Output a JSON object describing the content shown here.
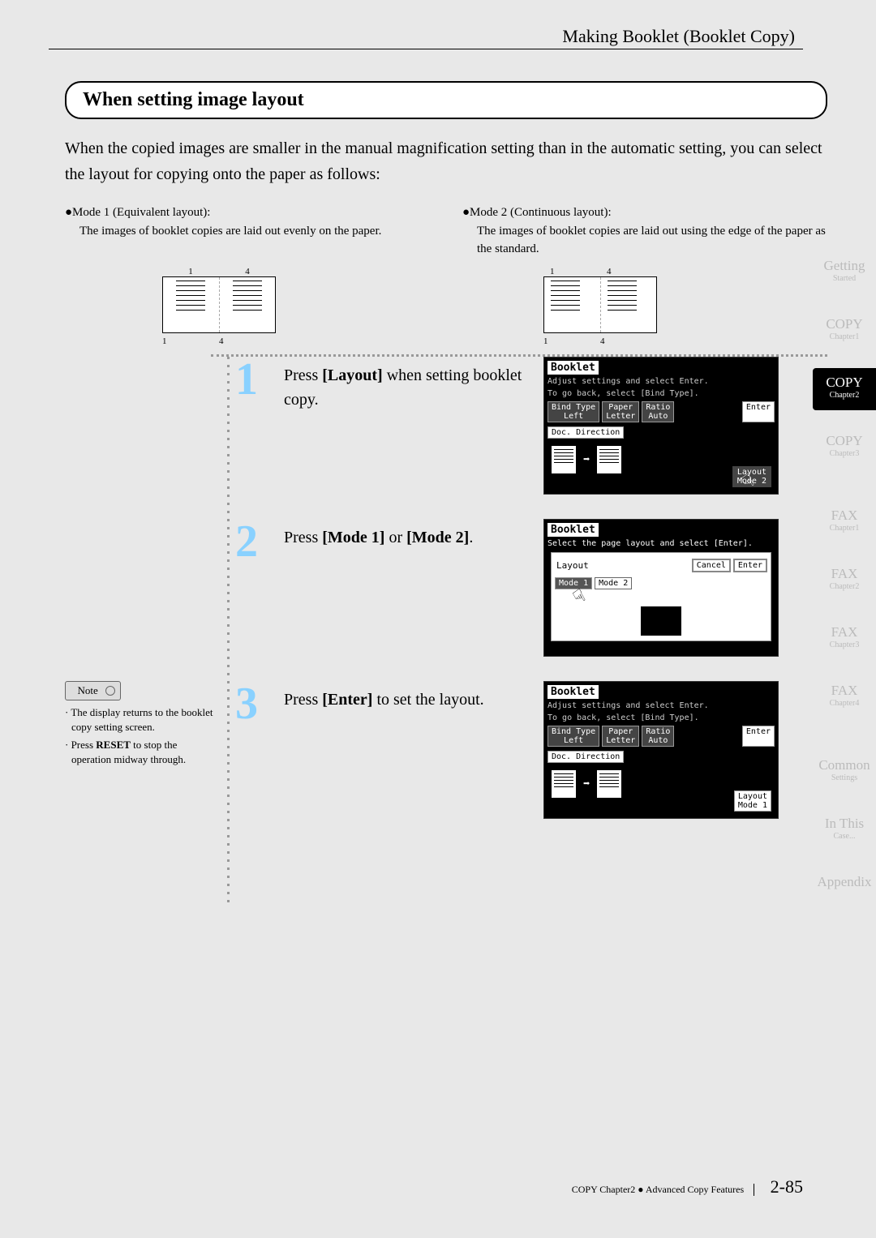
{
  "header": {
    "title": "Making Booklet (Booklet Copy)"
  },
  "section": {
    "title": "When setting image layout",
    "intro": "When the copied images are smaller in the manual magnification setting than in the automatic setting, you can select the layout for copying onto the paper as follows:"
  },
  "modes": {
    "mode1": {
      "title": "●Mode 1 (Equivalent layout):",
      "desc": "The images of booklet copies are laid out evenly on the paper."
    },
    "mode2": {
      "title": "●Mode 2 (Continuous layout):",
      "desc": "The images of booklet copies are laid out using the edge of the paper as the standard."
    },
    "num1": "1",
    "num4": "4"
  },
  "steps": {
    "s1": {
      "num": "1",
      "text_a": "Press ",
      "text_b": "[Layout]",
      "text_c": " when setting booklet copy."
    },
    "s2": {
      "num": "2",
      "text_a": "Press ",
      "text_b": "[Mode 1]",
      "text_c": " or ",
      "text_d": "[Mode 2]",
      "text_e": "."
    },
    "s3": {
      "num": "3",
      "text_a": "Press ",
      "text_b": "[Enter]",
      "text_c": " to set the layout."
    }
  },
  "panel": {
    "title": "Booklet",
    "sub1": "Adjust settings and select Enter.",
    "sub2": "To go back, select [Bind Type].",
    "bind_type": "Bind Type",
    "bind_left": "Left",
    "paper": "Paper",
    "paper_val": "Letter",
    "ratio": "Ratio",
    "ratio_val": "Auto",
    "enter": "Enter",
    "doc_dir": "Doc. Direction",
    "layout": "Layout",
    "mode2": "Mode 2",
    "mode1_btn": "Mode 1",
    "mode2_btn": "Mode 2",
    "cancel": "Cancel",
    "p2_sub": "Select the page layout and select [Enter].",
    "mode1_val": "Mode 1"
  },
  "note": {
    "head": "Note",
    "item1": "· The display returns to the booklet copy setting screen.",
    "item2_a": "· Press ",
    "item2_b": "RESET",
    "item2_c": " to stop the operation midway through."
  },
  "tabs": {
    "t1_main": "Getting",
    "t1_sub": "Started",
    "t2_main": "COPY",
    "t2_sub": "Chapter1",
    "t3_main": "COPY",
    "t3_sub": "Chapter2",
    "t4_main": "COPY",
    "t4_sub": "Chapter3",
    "t5_main": "FAX",
    "t5_sub": "Chapter1",
    "t6_main": "FAX",
    "t6_sub": "Chapter2",
    "t7_main": "FAX",
    "t7_sub": "Chapter3",
    "t8_main": "FAX",
    "t8_sub": "Chapter4",
    "t9_main": "Common",
    "t9_sub": "Settings",
    "t10_main": "In This",
    "t10_sub": "Case...",
    "t11_main": "Appendix",
    "t11_sub": ""
  },
  "footer": {
    "text": "COPY Chapter2 ● Advanced Copy Features",
    "num": "2-85"
  }
}
